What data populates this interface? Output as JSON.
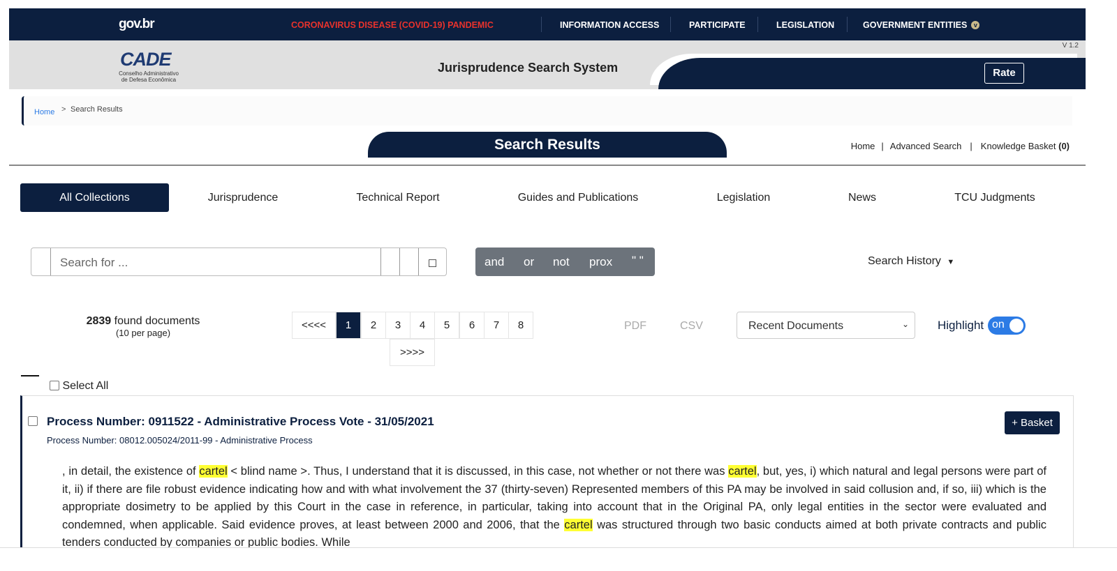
{
  "topbar": {
    "logo": "gov.br",
    "items": [
      {
        "label": "CORONAVIRUS DISEASE (COVID-19) PANDEMIC",
        "color": "#e8322c"
      },
      {
        "label": "INFORMATION ACCESS"
      },
      {
        "label": "PARTICIPATE"
      },
      {
        "label": "LEGISLATION"
      },
      {
        "label": "GOVERNMENT ENTITIES"
      }
    ]
  },
  "header": {
    "logo_text": "CADE",
    "logo_sub1": "Conselho Administrativo",
    "logo_sub2": "de Defesa Econômica",
    "title": "Jurisprudence Search System",
    "version": "V 1.2",
    "rate": "Rate"
  },
  "breadcrumb": {
    "home": "Home",
    "sep": ">",
    "current": "Search Results"
  },
  "results_tab": "Search Results",
  "top_links": {
    "home": "Home",
    "advanced": "Advanced Search",
    "basket": "Knowledge Basket",
    "basket_count": "(0)"
  },
  "collections": [
    "All Collections",
    "Jurisprudence",
    "Technical Report",
    "Guides and Publications",
    "Legislation",
    "News",
    "TCU Judgments"
  ],
  "search": {
    "placeholder": "Search for ..."
  },
  "operators": [
    "and",
    "or",
    "not",
    "prox",
    "\" \""
  ],
  "search_history": "Search History",
  "found": {
    "count": "2839",
    "label": "found documents",
    "per_page": "(10 per page)"
  },
  "pagination": {
    "prev": "<<<<",
    "pages": [
      "1",
      "2",
      "3",
      "4",
      "5",
      "6",
      "7",
      "8"
    ],
    "current": "1",
    "next": ">>>>"
  },
  "export": {
    "pdf": "PDF",
    "csv": "CSV"
  },
  "sort": {
    "selected": "Recent Documents"
  },
  "highlight": {
    "label": "Highlight",
    "state": "on"
  },
  "select_all": "Select All",
  "result": {
    "title": "Process Number: 0911522 - Administrative Process Vote - 31/05/2021",
    "subtitle": "Process Number: 08012.005024/2011-99 - Administrative Process",
    "basket": "+ Basket",
    "text_parts": [
      ", in detail, the existence of ",
      "cartel",
      " < blind name >. Thus, I understand that it is discussed, in this case, not whether or not there was ",
      "cartel",
      ", but, yes, i) which natural and legal persons were part of it, ii) if there are file robust evidence indicating how and with what involvement the 37 (thirty-seven) Represented members of this PA may be involved in said collusion and, if so, iii) which is the appropriate dosimetry to be applied by this Court in the case in reference, in particular, taking into account that in the Original PA, only legal entities in the sector were evaluated and condemned, when applicable. Said evidence proves, at least between 2000 and 2006, that the ",
      "cartel",
      " was structured through two basic conducts aimed at both private contracts and public tenders conducted by companies or public bodies. While"
    ]
  }
}
